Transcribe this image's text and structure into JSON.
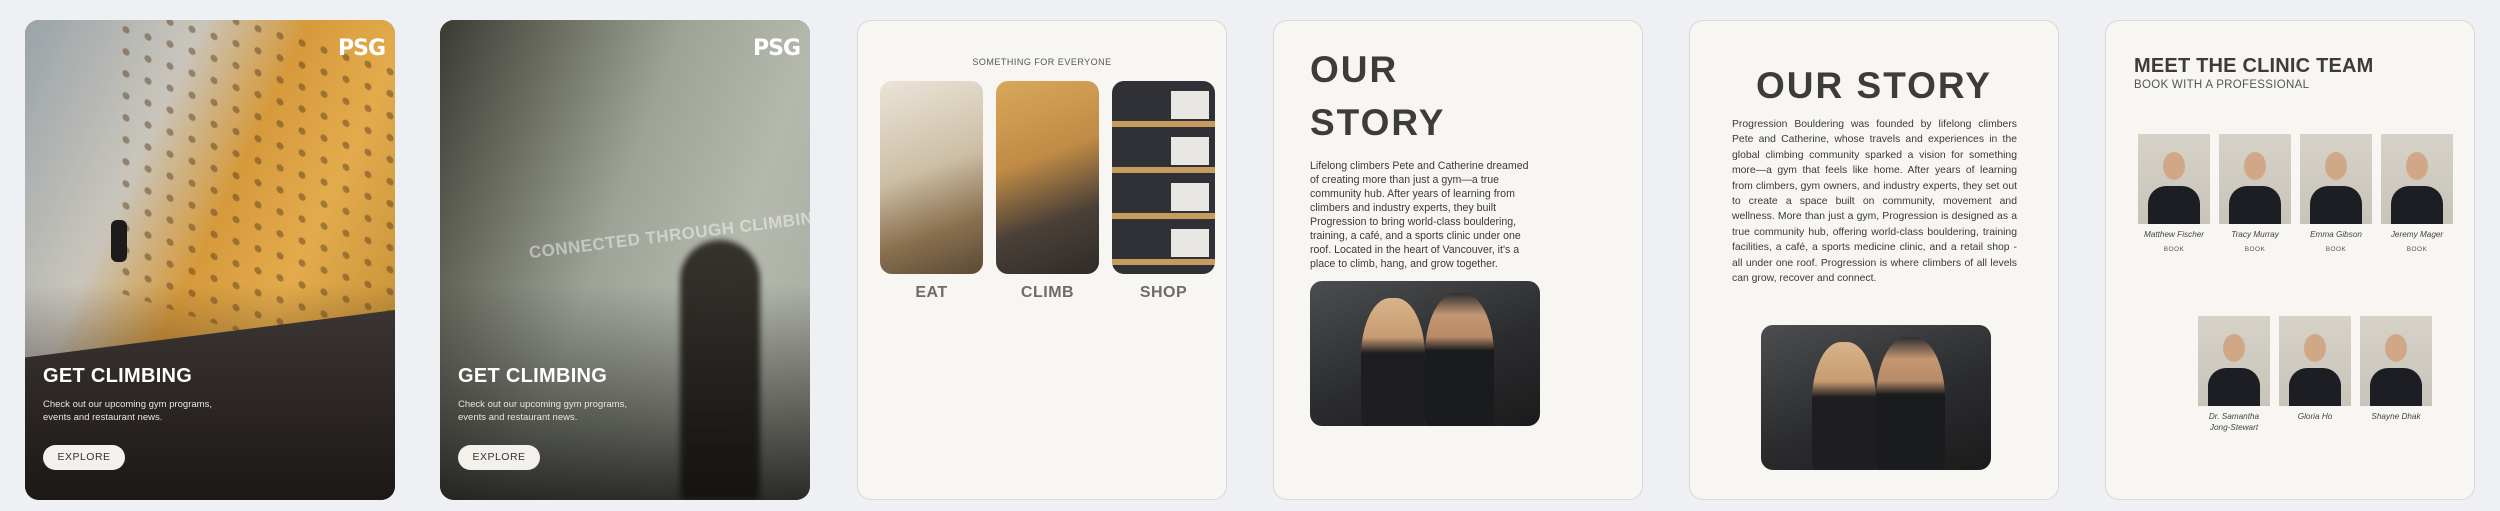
{
  "hero_cards": [
    {
      "logo": "PSG",
      "title": "GET CLIMBING",
      "subtitle": "Check out our upcoming gym programs, events and restaurant news.",
      "button": "EXPLORE"
    },
    {
      "logo": "PSG",
      "watermark": "CONNECTED THROUGH CLIMBING",
      "title": "GET CLIMBING",
      "subtitle": "Check out our upcoming gym programs, events and restaurant news.",
      "button": "EXPLORE"
    }
  ],
  "offerings": {
    "eyebrow": "SOMETHING FOR EVERYONE",
    "tiles": [
      "EAT",
      "CLIMB",
      "SHOP"
    ]
  },
  "story_short": {
    "title": "OUR STORY",
    "body": "Lifelong climbers Pete and Catherine dreamed of creating more than just a gym—a true community hub. After years of learning from climbers and industry experts, they built Progression to bring world-class bouldering, training, a café, and a sports clinic under one roof. Located in the heart of Vancouver, it's a place to climb, hang, and grow together."
  },
  "story_long": {
    "title": "OUR STORY",
    "body": "Progression Bouldering was founded by lifelong climbers Pete and Catherine, whose travels and experiences in the global climbing community sparked a vision for something more—a gym that feels like home. After years of learning from climbers, gym owners, and industry experts, they set out to create a space built on community, movement and wellness. More than just a gym, Progression is designed as a true community hub, offering world-class bouldering, training facilities, a café, a sports medicine clinic, and a retail shop - all under one roof. Progression is where climbers of all levels can grow, recover and connect."
  },
  "team": {
    "title": "MEET THE CLINIC TEAM",
    "subtitle": "BOOK WITH A  PROFESSIONAL",
    "row1": [
      {
        "name": "Matthew Fischer",
        "book": "BOOK"
      },
      {
        "name": "Tracy Murray",
        "book": "BOOK"
      },
      {
        "name": "Emma Gibson",
        "book": "BOOK"
      },
      {
        "name": "Jeremy Mager",
        "book": "BOOK"
      }
    ],
    "row2": [
      {
        "name": "Dr. Samantha Jong-Stewart"
      },
      {
        "name": "Gloria Ho"
      },
      {
        "name": "Shayne Dhak"
      }
    ]
  }
}
